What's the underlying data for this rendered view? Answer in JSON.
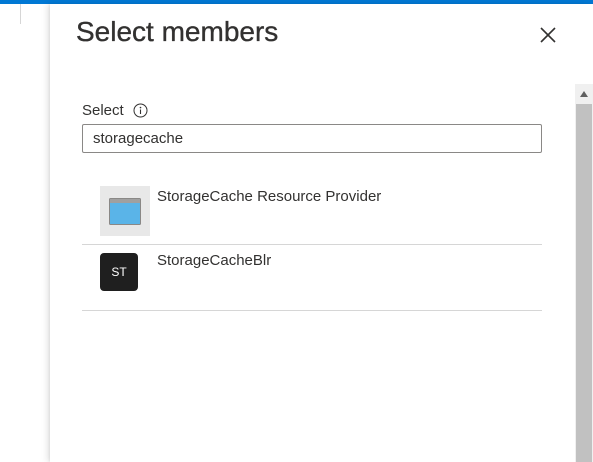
{
  "panel": {
    "title": "Select members",
    "close_icon": "close-icon"
  },
  "search": {
    "label": "Select",
    "info_icon": "info-icon",
    "value": "storagecache"
  },
  "results": [
    {
      "name": "StorageCache Resource Provider",
      "avatar_type": "app-icon"
    },
    {
      "name": "StorageCacheBlr",
      "avatar_type": "initials",
      "initials": "ST"
    }
  ],
  "colors": {
    "accent": "#0078d4",
    "text": "#323130",
    "initials_avatar_bg": "#1f1f1f",
    "app_icon_bg": "#e8e8e8",
    "app_icon_fill": "#5ab4e8",
    "scrollbar_thumb": "#c1c1c1"
  }
}
